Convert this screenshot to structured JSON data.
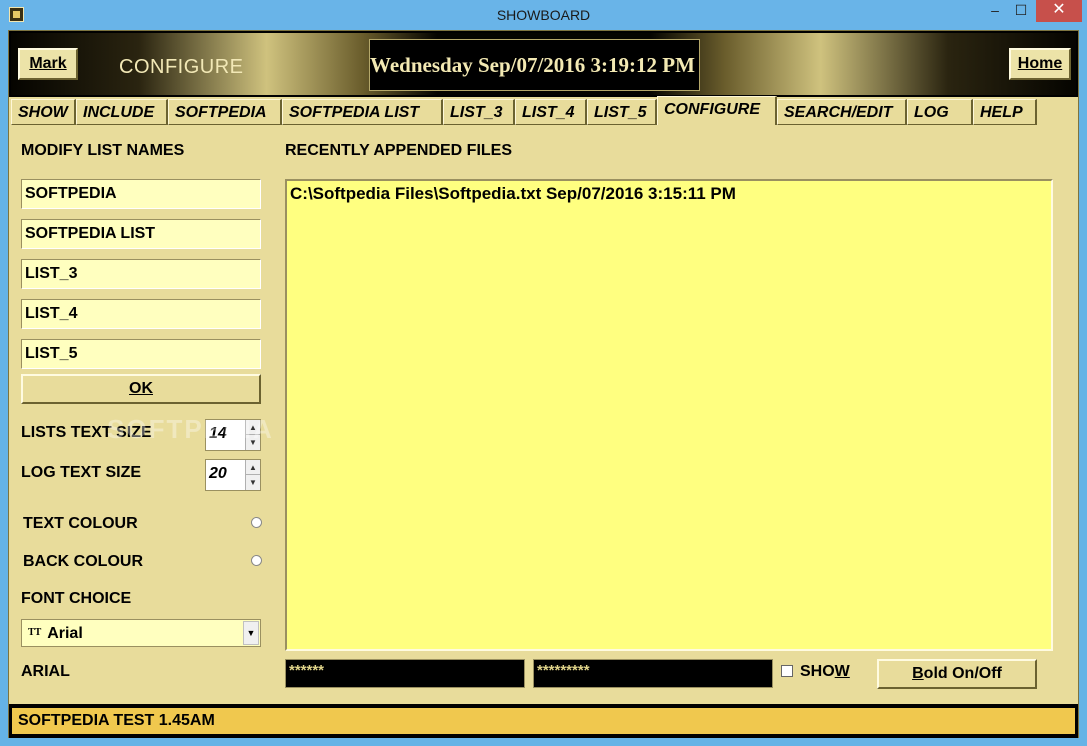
{
  "window": {
    "title": "SHOWBOARD",
    "minimize": "–",
    "maximize": "☐",
    "close": "✕"
  },
  "header": {
    "mark_label": "Mark",
    "home_label": "Home",
    "page_title": "CONFIGURE",
    "clock": "Wednesday  Sep/07/2016   3:19:12 PM"
  },
  "tabs": [
    "SHOW",
    "INCLUDE",
    "SOFTPEDIA",
    "SOFTPEDIA LIST",
    "LIST_3",
    "LIST_4",
    "LIST_5",
    "CONFIGURE",
    "SEARCH/EDIT",
    "LOG",
    "HELP"
  ],
  "active_tab": "CONFIGURE",
  "left": {
    "modify_label": "MODIFY LIST NAMES",
    "list_names": [
      "SOFTPEDIA",
      "SOFTPEDIA LIST",
      "LIST_3",
      "LIST_4",
      "LIST_5"
    ],
    "ok_label": "OK",
    "lists_text_size_label": "LISTS TEXT SIZE",
    "lists_text_size": "14",
    "log_text_size_label": "LOG TEXT SIZE",
    "log_text_size": "20",
    "text_colour_label": "TEXT COLOUR",
    "back_colour_label": "BACK COLOUR",
    "font_choice_label": "FONT CHOICE",
    "font_tt": "TT",
    "font_value": "Arial",
    "font_name_display": "ARIAL"
  },
  "right": {
    "recent_label": "RECENTLY APPENDED FILES",
    "recent_files": [
      "C:\\Softpedia Files\\Softpedia.txt Sep/07/2016 3:15:11 PM"
    ],
    "password1": "******",
    "password2": "*********",
    "show_prefix": "SHO",
    "show_suffix": "W",
    "bold_prefix": "B",
    "bold_suffix": "old On/Off"
  },
  "status": {
    "text": "SOFTPEDIA TEST 1.45AM"
  },
  "watermark": "SOFTPEDIA",
  "colors": {
    "background": "#e8dc9b",
    "input_bg": "#ffffbf",
    "files_bg": "#ffff80",
    "status_bg": "#f0c84e",
    "titlebar": "#69b4e8"
  }
}
